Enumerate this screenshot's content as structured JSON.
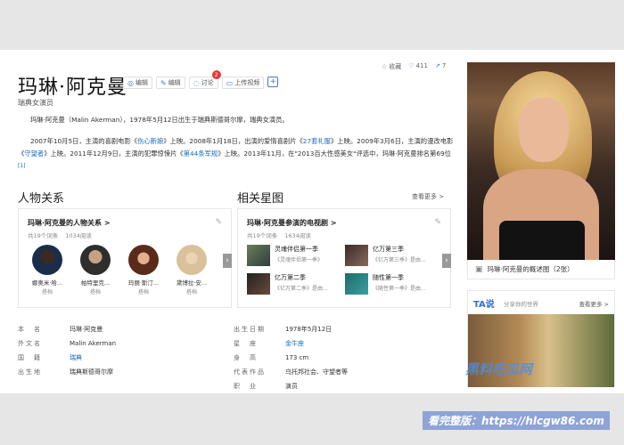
{
  "header": {
    "title": "玛琳·阿克曼",
    "subtitle": "瑞典女演员",
    "actions": [
      {
        "icon": "report-icon",
        "label": "编辑"
      },
      {
        "icon": "edit-icon",
        "label": "编辑"
      },
      {
        "icon": "discuss-icon",
        "label": "讨论",
        "badge": "2"
      },
      {
        "icon": "video-icon",
        "label": "上传视频"
      }
    ],
    "stats": {
      "favorite": "收藏",
      "likes": "411",
      "shares": "7"
    }
  },
  "paragraphs": {
    "p1": "玛琳·阿克曼（Malin Akerman），1978年5月12日出生于瑞典斯德哥尔摩，瑞典女演员。",
    "p2_a": "2007年10月5日，主演的喜剧电影《",
    "p2_link1": "伤心新娘",
    "p2_b": "》上映。2008年1月18日，出演的爱情喜剧片《",
    "p2_link2": "27套礼服",
    "p2_c": "》上映。2009年3月6日，主演的漫改电影《",
    "p2_link3": "守望者",
    "p2_d": "》上映。2011年12月9日，主演的犯罪惊悚片《",
    "p2_link4": "第44条军规",
    "p2_e": "》上映。2013年11月，在\"2013百大性感美女\"评选中，玛琳·阿克曼排名第69位",
    "p2_sup": "[1]"
  },
  "relations": {
    "section_title": "人物关系",
    "card_title": "玛琳·阿克曼的人物关系 >",
    "entries": "共19个词条",
    "reads": "1034阅读",
    "people": [
      {
        "name": "娜奥米·哈...",
        "role": "搭档"
      },
      {
        "name": "帕特里克...",
        "role": "搭档"
      },
      {
        "name": "玛丽·斯汀...",
        "role": "搭档"
      },
      {
        "name": "黛博拉·安...",
        "role": "搭档"
      }
    ]
  },
  "related": {
    "section_title": "相关星图",
    "more": "查看更多 >",
    "card_title": "玛琳·阿克曼参演的电视剧 >",
    "entries": "共19个词条",
    "reads": "1634阅读",
    "shows": [
      {
        "title": "灵魂伴侣第一季",
        "sub": "《灵魂伴侣第一季》"
      },
      {
        "title": "亿万第三季",
        "sub": "《亿万第三季》是由..."
      },
      {
        "title": "亿万第二季",
        "sub": "《亿万第二季》是由..."
      },
      {
        "title": "随性第一季",
        "sub": "《随性第一季》是由..."
      }
    ]
  },
  "info": [
    {
      "k1": "本　名",
      "v1": "玛琳·阿克曼",
      "k2": "出生日期",
      "v2": "1978年5月12日"
    },
    {
      "k1": "外文名",
      "v1": "Malin Akerman",
      "k2": "星　座",
      "v2": "金牛座",
      "v2link": true
    },
    {
      "k1": "国　籍",
      "v1": "瑞典",
      "v1link": true,
      "k2": "身　高",
      "v2": "173 cm"
    },
    {
      "k1": "出生地",
      "v1": "瑞典斯德哥尔摩",
      "k2": "代表作品",
      "v2": "乌托邦社会、守望者等"
    },
    {
      "k1": "",
      "v1": "",
      "k2": "职　业",
      "v2": "演员"
    }
  ],
  "side": {
    "photo_caption": "玛琳·阿克曼的概述图（2张）",
    "ta_logo": "TA说",
    "ta_sub": "分享你的世界",
    "ta_more": "查看更多 >"
  },
  "watermarks": {
    "w1": "黑料吃瓜网",
    "w2": "看完整版：https://hlcgw86.com"
  }
}
